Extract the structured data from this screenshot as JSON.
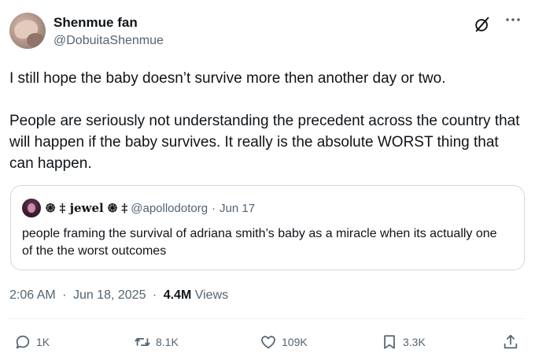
{
  "tweet": {
    "author": {
      "display_name": "Shenmue fan",
      "handle": "@DobuitaShenmue"
    },
    "paragraphs": [
      "I still hope the baby doesn’t survive more then another day or two.",
      "People are seriously not understanding the precedent across the country that will happen if the baby survives. It really is the absolute WORST thing that can happen."
    ],
    "quoted": {
      "display_name": "🌀🢟 jewel 🌀🢟",
      "name_parts": {
        "pre_icons": "֎ ‡",
        "name": "jewel",
        "post_icons": "֎ ‡"
      },
      "handle": "@apollodotorg",
      "separator": "·",
      "date": "Jun 17",
      "text": "people framing the survival of adriana smith’s baby as a miracle when its actually one of the the worst outcomes"
    },
    "meta": {
      "time": "2:06 AM",
      "date": "Jun 18, 2025",
      "separator": "·",
      "views_count": "4.4M",
      "views_label": "Views"
    },
    "actions": {
      "replies": "1K",
      "reposts": "8.1K",
      "likes": "109K",
      "bookmarks": "3.3K"
    }
  },
  "icons": {
    "grok": "grok-icon",
    "more": "more-icon",
    "reply": "reply-icon",
    "repost": "repost-icon",
    "like": "heart-icon",
    "bookmark": "bookmark-icon",
    "share": "share-icon"
  },
  "colors": {
    "text": "#0f1419",
    "secondary": "#536471",
    "border": "#cfd9de"
  }
}
